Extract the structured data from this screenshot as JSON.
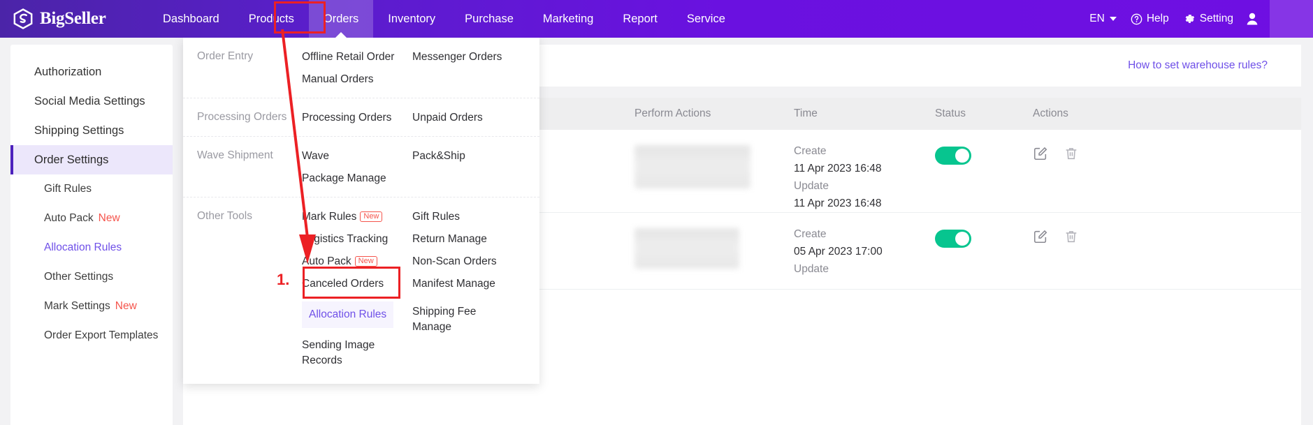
{
  "brand": {
    "name": "BigSeller",
    "logo_icon": "bigseller-logo-icon"
  },
  "topnav": {
    "items": [
      {
        "label": "Dashboard",
        "active": false
      },
      {
        "label": "Products",
        "active": false
      },
      {
        "label": "Orders",
        "active": true
      },
      {
        "label": "Inventory",
        "active": false
      },
      {
        "label": "Purchase",
        "active": false
      },
      {
        "label": "Marketing",
        "active": false
      },
      {
        "label": "Report",
        "active": false
      },
      {
        "label": "Service",
        "active": false
      }
    ],
    "language": "EN",
    "help": "Help",
    "setting": "Setting",
    "icons": {
      "language_caret": "chevron-down-icon",
      "help": "question-circle-icon",
      "setting": "gear-icon",
      "account": "user-avatar-icon"
    }
  },
  "sidebar": {
    "items": [
      {
        "label": "Authorization",
        "level": "top",
        "active": false,
        "link": false,
        "badge": ""
      },
      {
        "label": "Social Media Settings",
        "level": "top",
        "active": false,
        "link": false,
        "badge": ""
      },
      {
        "label": "Shipping Settings",
        "level": "top",
        "active": false,
        "link": false,
        "badge": ""
      },
      {
        "label": "Order Settings",
        "level": "top",
        "active": true,
        "link": false,
        "badge": ""
      },
      {
        "label": "Gift Rules",
        "level": "sub",
        "active": false,
        "link": false,
        "badge": ""
      },
      {
        "label": "Auto Pack",
        "level": "sub",
        "active": false,
        "link": false,
        "badge": "New"
      },
      {
        "label": "Allocation Rules",
        "level": "sub",
        "active": false,
        "link": true,
        "badge": ""
      },
      {
        "label": "Other Settings",
        "level": "sub",
        "active": false,
        "link": false,
        "badge": ""
      },
      {
        "label": "Mark Settings",
        "level": "sub",
        "active": false,
        "link": false,
        "badge": "New"
      },
      {
        "label": "Order Export Templates",
        "level": "sub",
        "active": false,
        "link": false,
        "badge": ""
      }
    ]
  },
  "mega_menu": {
    "groups": [
      {
        "category": "Order Entry",
        "col1": [
          {
            "label": "Offline Retail Order",
            "badge": "",
            "highlight": false,
            "multiline": false
          },
          {
            "label": "Manual Orders",
            "badge": "",
            "highlight": false,
            "multiline": false
          }
        ],
        "col2": [
          {
            "label": "Messenger Orders",
            "badge": "",
            "highlight": false,
            "multiline": false
          }
        ]
      },
      {
        "category": "Processing Orders",
        "col1": [
          {
            "label": "Processing Orders",
            "badge": "",
            "highlight": false,
            "multiline": false
          }
        ],
        "col2": [
          {
            "label": "Unpaid Orders",
            "badge": "",
            "highlight": false,
            "multiline": false
          }
        ]
      },
      {
        "category": "Wave Shipment",
        "col1": [
          {
            "label": "Wave",
            "badge": "",
            "highlight": false,
            "multiline": false
          },
          {
            "label": "Package Manage",
            "badge": "",
            "highlight": false,
            "multiline": false
          }
        ],
        "col2": [
          {
            "label": "Pack&Ship",
            "badge": "",
            "highlight": false,
            "multiline": false
          }
        ]
      },
      {
        "category": "Other Tools",
        "col1": [
          {
            "label": "Mark Rules",
            "badge": "New",
            "highlight": false,
            "multiline": false
          },
          {
            "label": "Logistics Tracking",
            "badge": "",
            "highlight": false,
            "multiline": false
          },
          {
            "label": "Auto Pack",
            "badge": "New",
            "highlight": false,
            "multiline": false
          },
          {
            "label": "Canceled Orders",
            "badge": "",
            "highlight": false,
            "multiline": false
          },
          {
            "label": "Allocation Rules",
            "badge": "",
            "highlight": true,
            "multiline": false
          },
          {
            "label": "Sending Image Records",
            "badge": "",
            "highlight": false,
            "multiline": true
          }
        ],
        "col2": [
          {
            "label": "Gift Rules",
            "badge": "",
            "highlight": false,
            "multiline": false
          },
          {
            "label": "Return Manage",
            "badge": "",
            "highlight": false,
            "multiline": false
          },
          {
            "label": "Non-Scan Orders",
            "badge": "",
            "highlight": false,
            "multiline": false
          },
          {
            "label": "Manifest Manage",
            "badge": "",
            "highlight": false,
            "multiline": false
          },
          {
            "label": "Shipping Fee Manage",
            "badge": "",
            "highlight": false,
            "multiline": true
          }
        ]
      }
    ]
  },
  "main": {
    "help_link": "How to set warehouse rules?",
    "table": {
      "columns": [
        "Perform Actions",
        "Time",
        "Status",
        "Actions"
      ],
      "rows": [
        {
          "perform_actions": "",
          "create_label": "Create",
          "create_time": "11 Apr 2023 16:48",
          "update_label": "Update",
          "update_time": "11 Apr 2023 16:48",
          "status_on": true,
          "edit_icon": "edit-pencil-icon",
          "delete_icon": "trash-icon"
        },
        {
          "perform_actions": "",
          "create_label": "Create",
          "create_time": "05 Apr 2023 17:00",
          "update_label": "Update",
          "update_time": "",
          "status_on": true,
          "edit_icon": "edit-pencil-icon",
          "delete_icon": "trash-icon"
        }
      ]
    }
  },
  "annotations": {
    "step_number": "1.",
    "color": "#ec2024",
    "highlight_orders": "Orders",
    "highlight_allocation_rules": "Allocation Rules"
  }
}
